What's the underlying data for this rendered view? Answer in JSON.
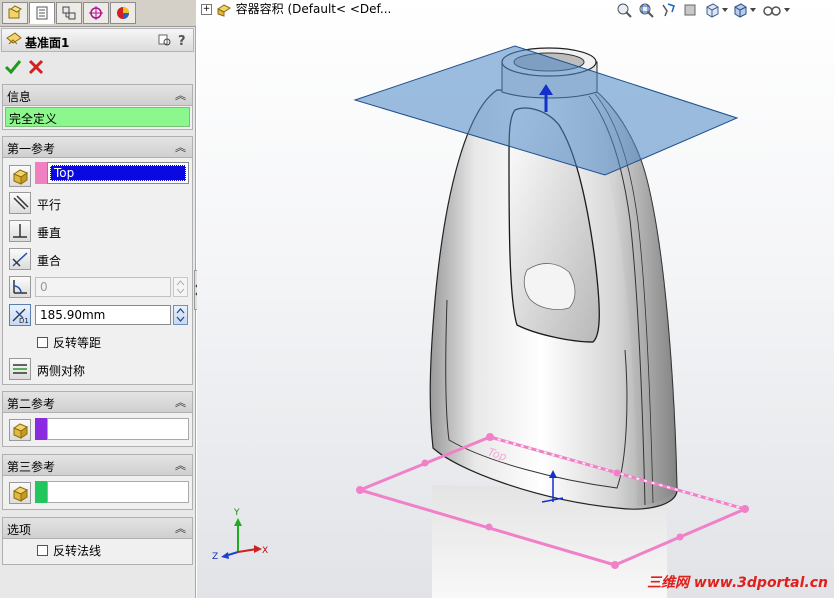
{
  "property_manager": {
    "title": "基准面1",
    "tabs": [
      "feature-manager",
      "property-manager",
      "configuration-manager",
      "dimxpert-manager",
      "display-manager"
    ],
    "info_group": {
      "title": "信息",
      "status": "完全定义",
      "status_color": "#8cf78c"
    },
    "first_reference": {
      "title": "第一参考",
      "selection": "Top",
      "swatch_color": "#f080c0",
      "options": {
        "parallel": "平行",
        "perpendicular": "垂直",
        "coincident": "重合"
      },
      "angle_value": "0",
      "distance_value": "185.90mm",
      "flip_offset": "反转等距",
      "mid_plane": "两侧对称"
    },
    "second_reference": {
      "title": "第二参考",
      "swatch_color": "#8a2be2"
    },
    "third_reference": {
      "title": "第三参考",
      "swatch_color": "#22c55e"
    },
    "options_group": {
      "title": "选项",
      "flip_normal": "反转法线"
    }
  },
  "viewport": {
    "tree_label": "容器容积   (Default< <Def...",
    "triad": {
      "x": "X",
      "y": "Y",
      "z": "Z"
    },
    "watermark": "三维网 www.3dportal.cn"
  }
}
